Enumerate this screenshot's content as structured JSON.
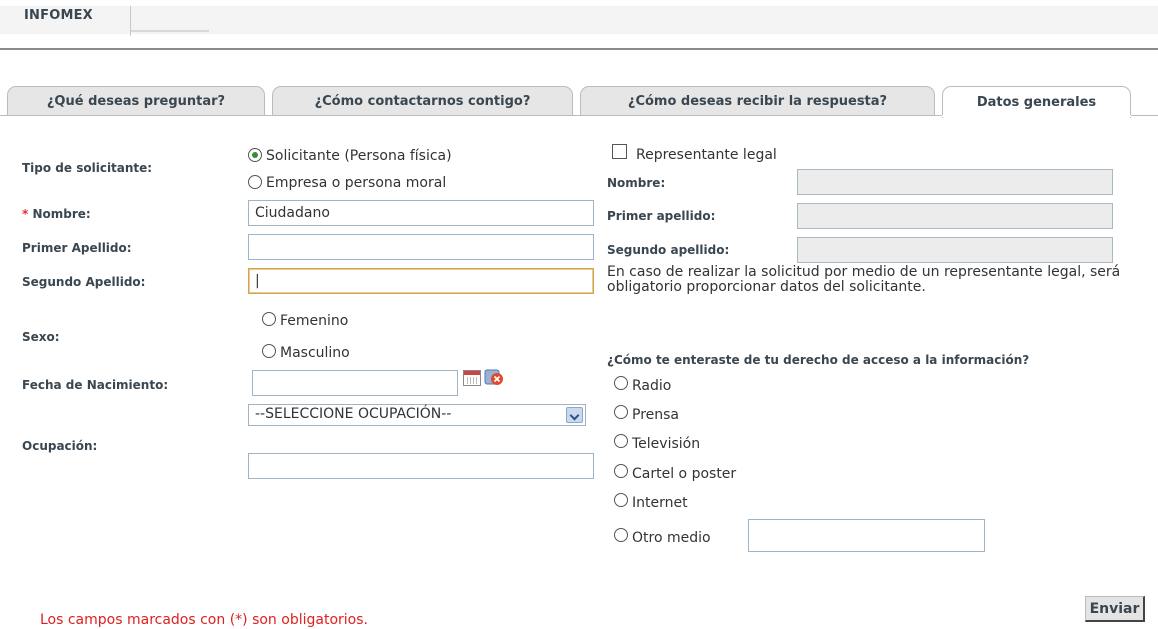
{
  "header": {
    "title": "INFOMEX"
  },
  "tabs": [
    {
      "label": "¿Qué deseas preguntar?"
    },
    {
      "label": "¿Cómo contactarnos contigo?"
    },
    {
      "label": "¿Cómo deseas recibir la respuesta?"
    },
    {
      "label": "Datos generales"
    }
  ],
  "form": {
    "tipo_label": "Tipo de solicitante:",
    "tipo_options": [
      "Solicitante (Persona física)",
      "Empresa o persona moral"
    ],
    "tipo_selected": "Solicitante (Persona física)",
    "required_mark": "*",
    "nombre_label": "Nombre:",
    "nombre_value": "Ciudadano",
    "primer_apellido_label": "Primer Apellido:",
    "primer_apellido_value": "",
    "segundo_apellido_label": "Segundo Apellido:",
    "segundo_apellido_value": "|",
    "sexo_label": "Sexo:",
    "sexo_options": [
      "Femenino",
      "Masculino"
    ],
    "fecha_label": "Fecha de Nacimiento:",
    "fecha_value": "",
    "ocupacion_label": "Ocupación:",
    "ocupacion_selected": "--SELECCIONE OCUPACIÓN--",
    "ocupacion_other_value": ""
  },
  "representante": {
    "checkbox_label": "Representante legal",
    "nombre_label": "Nombre:",
    "primer_apellido_label": "Primer apellido:",
    "segundo_apellido_label": "Segundo apellido:",
    "info_text": "En caso de realizar la solicitud por medio de un representante legal, será obligatorio proporcionar datos del solicitante."
  },
  "enteraste": {
    "question": "¿Cómo te enteraste de tu derecho de acceso a la información?",
    "options": [
      "Radio",
      "Prensa",
      "Televisión",
      "Cartel o poster",
      "Internet",
      "Otro medio"
    ],
    "otro_value": ""
  },
  "actions": {
    "submit_label": "Enviar"
  },
  "footnote": "Los campos marcados con (*) son obligatorios.",
  "colors": {
    "required": "#e02020",
    "label": "#3a4650",
    "focus_border": "#d6a24a"
  }
}
